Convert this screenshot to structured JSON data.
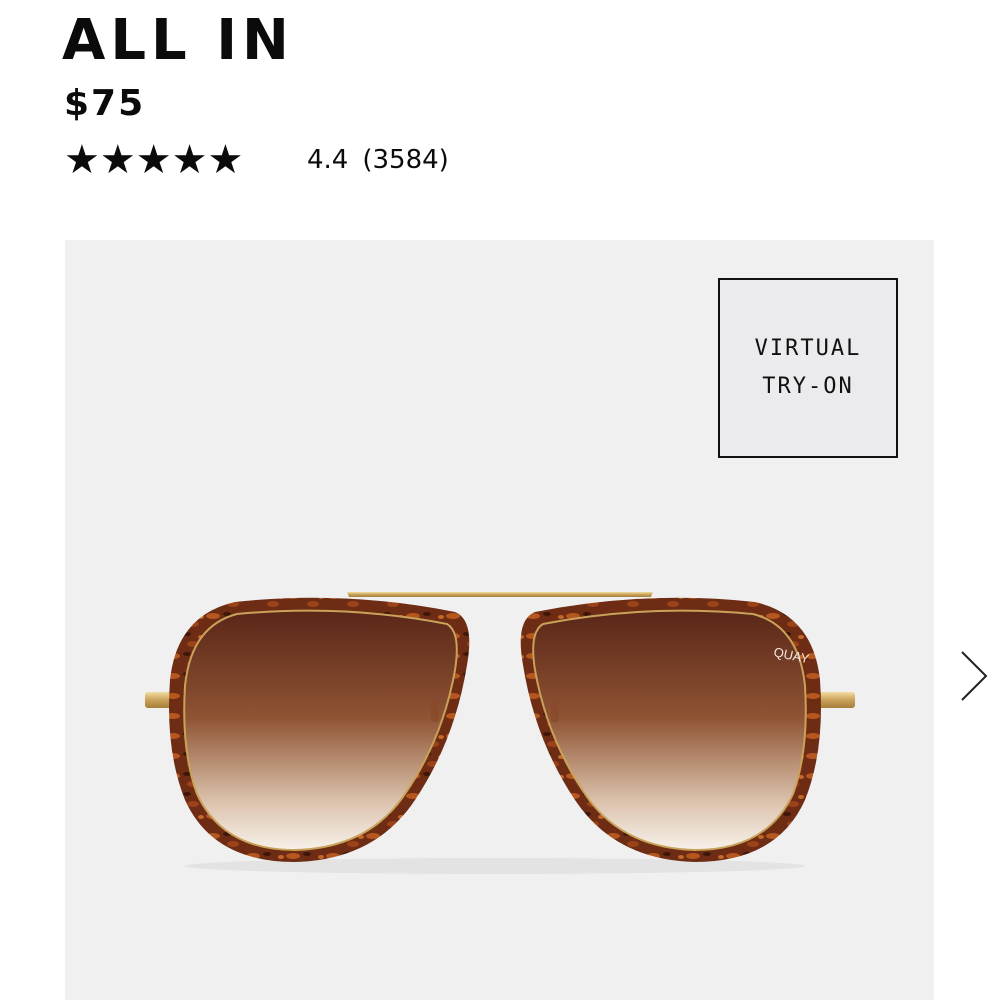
{
  "product": {
    "name": "ALL IN",
    "price": "$75",
    "rating": {
      "stars_text": "★★★★★",
      "value_fraction": 0.88,
      "score": "4.4",
      "count": "(3584)"
    }
  },
  "virtual_try_on": {
    "line1": "VIRTUAL",
    "line2": "TRY-ON"
  },
  "image": {
    "brand_mark": "QUAY",
    "alt": "sunglasses-product-image"
  },
  "colors": {
    "panel_bg": "#f0f0f0",
    "text": "#0b0b0b",
    "lens_top": "#5a2a1c",
    "lens_bottom": "#f5efe8",
    "frame_tortoise": "#7a3418",
    "gold": "#d4b06a"
  },
  "icons": {
    "next": "chevron-right-icon",
    "star": "star-icon"
  }
}
